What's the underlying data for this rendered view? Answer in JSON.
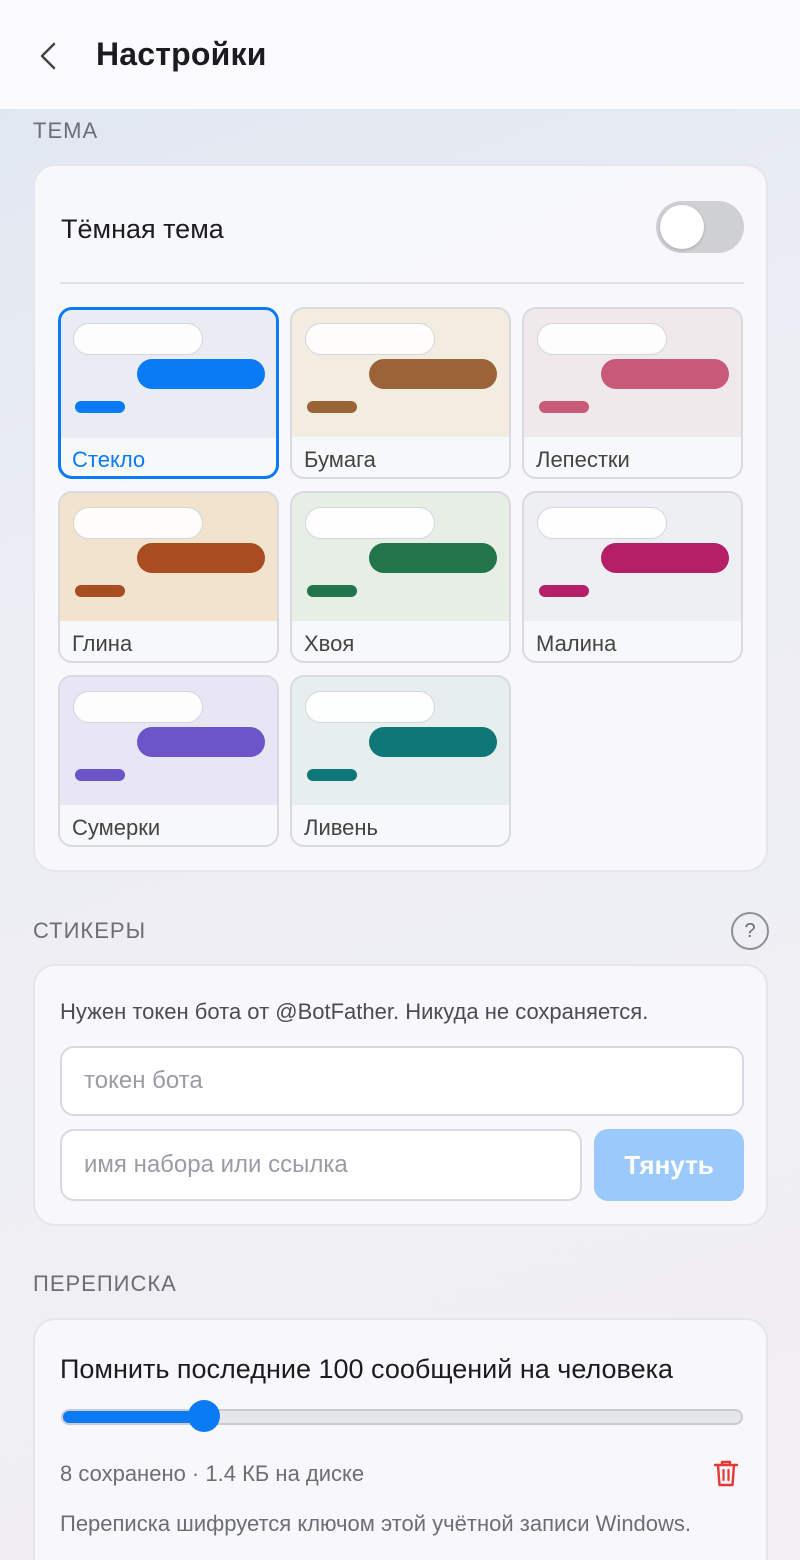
{
  "header": {
    "title": "Настройки",
    "back_icon": "chevron-left-icon"
  },
  "theme_section": {
    "title": "ТЕМА",
    "dark_mode_label": "Тёмная тема",
    "dark_mode_on": false,
    "selected": "Стекло",
    "themes": [
      {
        "label": "Стекло",
        "accent": "#0a7bf5",
        "bg": "#e9ecf2"
      },
      {
        "label": "Бумага",
        "accent": "#9a6438",
        "bg": "#f3ece0"
      },
      {
        "label": "Лепестки",
        "accent": "#c75a78",
        "bg": "#efe9ec"
      },
      {
        "label": "Глина",
        "accent": "#a84c22",
        "bg": "#f1e3cd"
      },
      {
        "label": "Хвоя",
        "accent": "#22744a",
        "bg": "#e7eee6"
      },
      {
        "label": "Малина",
        "accent": "#b41f68",
        "bg": "#eeeff2"
      },
      {
        "label": "Сумерки",
        "accent": "#6b55c8",
        "bg": "#e8e5f4"
      },
      {
        "label": "Ливень",
        "accent": "#0f7777",
        "bg": "#e6eeee"
      }
    ]
  },
  "stickers_section": {
    "title": "СТИКЕРЫ",
    "help_label": "?",
    "hint": "Нужен токен бота от @BotFather. Никуда не сохраняется.",
    "token_placeholder": "токен бота",
    "token_value": "",
    "set_placeholder": "имя набора или ссылка",
    "set_value": "",
    "pull_label": "Тянуть"
  },
  "chat_section": {
    "title": "ПЕРЕПИСКА",
    "remember_label": "Помнить последние 100 сообщений на человека",
    "slider_fraction": 0.21,
    "stats": "8 сохранено · 1.4 КБ на диске",
    "trash_icon": "trash-icon",
    "note": "Переписка шифруется ключом этой учётной записи Windows."
  },
  "colors": {
    "accent": "#0a7bf5",
    "danger": "#e53935"
  }
}
